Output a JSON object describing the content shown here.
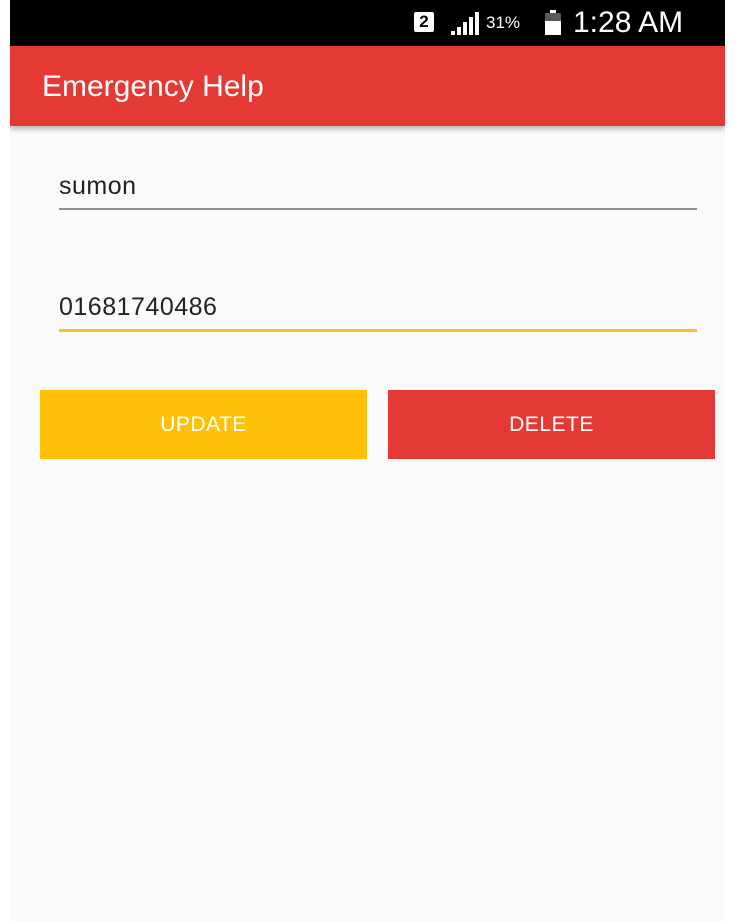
{
  "status_bar": {
    "sim_slot": "2",
    "signal_icon": "signal-bars-icon",
    "battery_percent": "31%",
    "battery_icon": "battery-icon",
    "time": "1:28 AM"
  },
  "app_bar": {
    "title": "Emergency Help",
    "color": "#e53935"
  },
  "form": {
    "name_value": "sumon",
    "phone_value": "01681740486"
  },
  "buttons": {
    "update_label": "UPDATE",
    "update_color": "#ffc107",
    "delete_label": "DELETE",
    "delete_color": "#e53935"
  }
}
